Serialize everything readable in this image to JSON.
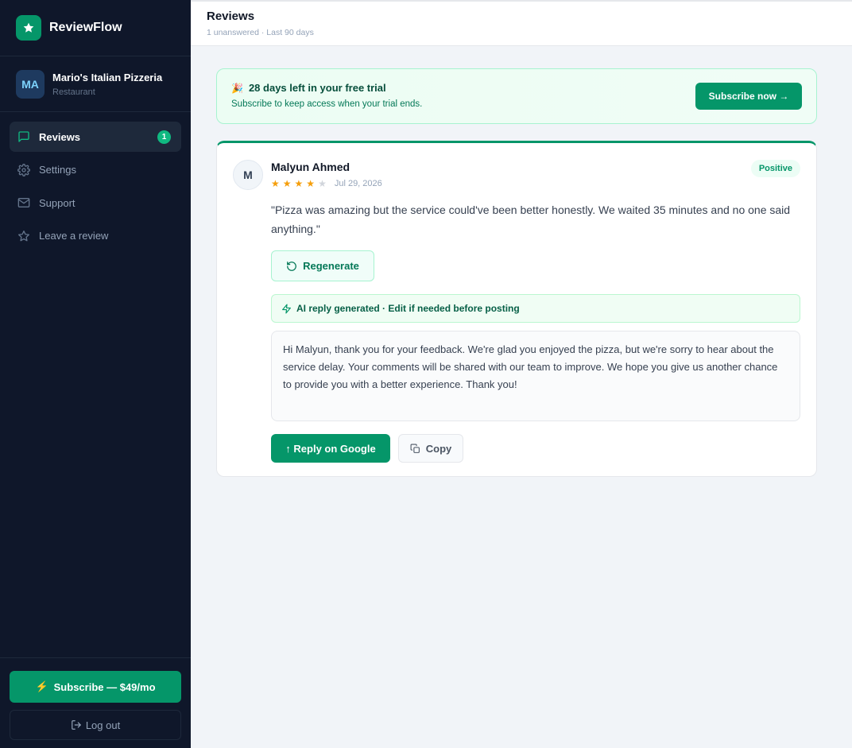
{
  "brand": {
    "name": "ReviewFlow",
    "logo_icon": "star-icon",
    "accent": "#059669"
  },
  "business": {
    "initials": "MA",
    "name": "Mario's Italian Pizzeria",
    "type": "Restaurant"
  },
  "nav": {
    "items": [
      {
        "label": "Reviews",
        "icon": "chat-bubble-icon",
        "active": true,
        "badge": "1"
      },
      {
        "label": "Settings",
        "icon": "gear-icon"
      },
      {
        "label": "Support",
        "icon": "mail-icon"
      },
      {
        "label": "Leave a review",
        "icon": "star-outline-icon"
      }
    ]
  },
  "sidebar_footer": {
    "subscribe_label": "Subscribe — $49/mo",
    "logout_label": "Log out"
  },
  "header": {
    "title": "Reviews",
    "subtitle": "1 unanswered · Last 90 days"
  },
  "trial": {
    "emoji": "🎉",
    "title": "28 days left in your free trial",
    "subtitle": "Subscribe to keep access when your trial ends.",
    "button_label": "Subscribe now →"
  },
  "review": {
    "avatar_initial": "M",
    "reviewer": "Malyun Ahmed",
    "rating": 4,
    "max_rating": 5,
    "date": "Jul 29, 2026",
    "sentiment": "Positive",
    "text": "\"Pizza was amazing but the service could've been better honestly. We waited 35 minutes and no one said anything.\"",
    "regenerate_label": "Regenerate",
    "ai_note": "AI reply generated · Edit if needed before posting",
    "reply": "Hi Malyun, thank you for your feedback. We're glad you enjoyed the pizza, but we're sorry to hear about the service delay. Your comments will be shared with our team to improve. We hope you give us another chance to provide you with a better experience. Thank you!",
    "reply_google_label": "↑ Reply on Google",
    "copy_label": "Copy"
  }
}
